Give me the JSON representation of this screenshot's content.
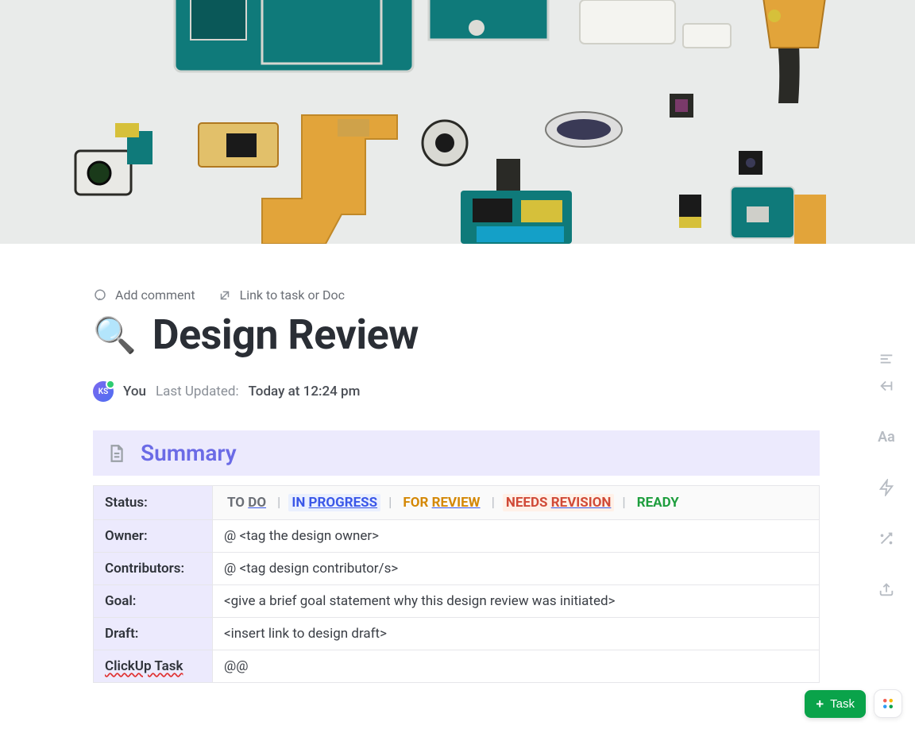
{
  "header": {
    "add_comment": "Add comment",
    "link_task": "Link to task or Doc"
  },
  "title": {
    "icon": "🔍",
    "text": "Design Review"
  },
  "byline": {
    "avatar_initials": "KS",
    "you": "You",
    "last_updated_label": "Last Updated:",
    "last_updated_time": "Today at 12:24 pm"
  },
  "summary": {
    "heading": "Summary",
    "status_chips": {
      "todo": {
        "prefix": "TO",
        "link": "DO"
      },
      "inprogress": {
        "prefix": "IN",
        "link": "PROGRESS"
      },
      "review": {
        "prefix": "FOR",
        "link": "REVIEW"
      },
      "revision": {
        "prefix": "NEEDS",
        "link": "REVISION"
      },
      "ready": "READY"
    },
    "rows": {
      "status_label": "Status:",
      "owner_label": "Owner:",
      "owner_value": "@ <tag the design owner>",
      "contributors_label": "Contributors:",
      "contributors_value": "@ <tag design contributor/s>",
      "goal_label": "Goal:",
      "goal_value": "<give a brief goal statement why this design review was initiated>",
      "draft_label": "Draft:",
      "draft_value": "<insert link to design draft>",
      "clickup_label": "ClickUp Task",
      "clickup_value": "@@"
    }
  },
  "side_toolbar": {
    "align": "align-left",
    "indent": "indent-left",
    "font": "Aa",
    "magic_1": "lightning",
    "magic_2": "wand",
    "share": "share"
  },
  "bottom": {
    "task_button": "Task"
  }
}
